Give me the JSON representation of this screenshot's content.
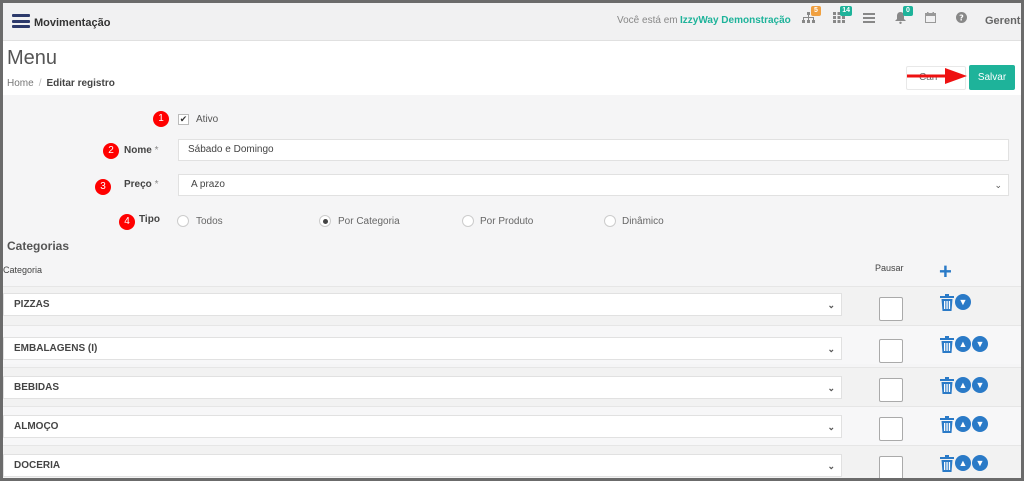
{
  "topbar": {
    "module_title": "Movimentação",
    "env_label": "Você está em :",
    "env_name": "IzzyWay Demonstração",
    "icons": [
      {
        "name": "sitemap-icon",
        "badge": "5",
        "badge_color": "#f0a040"
      },
      {
        "name": "grid-icon",
        "badge": "14",
        "badge_color": "#1eb39a"
      },
      {
        "name": "list-icon",
        "badge": "",
        "badge_color": ""
      },
      {
        "name": "bell-icon",
        "badge": "0",
        "badge_color": "#1eb39a"
      },
      {
        "name": "calendar-icon",
        "badge": "",
        "badge_color": ""
      },
      {
        "name": "help-icon",
        "badge": "",
        "badge_color": ""
      }
    ],
    "user_name": "Gerente"
  },
  "header": {
    "title": "Menu",
    "breadcrumb": {
      "home": "Home",
      "sep": "/",
      "current": "Editar registro"
    },
    "cancel_label": "Can",
    "save_label": "Salvar"
  },
  "form": {
    "markers": [
      "1",
      "2",
      "3",
      "4"
    ],
    "active_label": "Ativo",
    "active_checked": true,
    "name_label": "Nome",
    "name_value": "Sábado e Domingo",
    "price_label": "Preço",
    "price_value": "A prazo",
    "required_mark": "*",
    "type_label": "Tipo",
    "type_options": [
      "Todos",
      "Por Categoria",
      "Por Produto",
      "Dinâmico"
    ],
    "type_selected": "Por Categoria"
  },
  "categories": {
    "title": "Categorias",
    "col_category": "Categoria",
    "col_pause": "Pausar",
    "add_label": "+",
    "rows": [
      {
        "name": "PIZZAS"
      },
      {
        "name": "EMBALAGENS (I)"
      },
      {
        "name": "BEBIDAS"
      },
      {
        "name": "ALMOÇO"
      },
      {
        "name": "DOCERIA"
      }
    ]
  },
  "colors": {
    "accent": "#1eb39a",
    "action_blue": "#2a7ac7",
    "marker_red": "#ff0000"
  }
}
